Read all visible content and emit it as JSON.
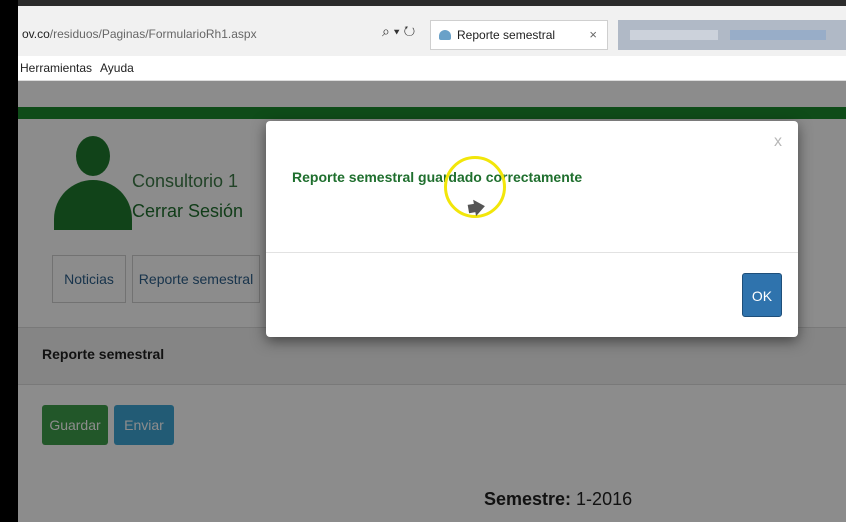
{
  "browser": {
    "url_prefix": "ov.co",
    "url_path": "/residuos/Paginas/FormularioRh1.aspx",
    "url_actions": "⌕ ▾ ↻",
    "tab_title": "Reporte semestral",
    "tab_close": "×"
  },
  "menubar": {
    "items": [
      "Herramientas",
      "Ayuda"
    ]
  },
  "page": {
    "user_label": "Consultorio 1",
    "logout_label": "Cerrar Sesión",
    "tabs": [
      "Noticias",
      "Reporte semestral"
    ],
    "panel_title": "Reporte semestral",
    "buttons": {
      "guardar": "Guardar",
      "enviar": "Enviar"
    },
    "semestre_label": "Semestre:",
    "semestre_value": " 1-2016"
  },
  "modal": {
    "close": "x",
    "message": "Reporte semestral guardado correctamente",
    "ok": "OK"
  },
  "colors": {
    "green": "#1c8a2e",
    "ok_button": "#2f73ad",
    "guardar_button": "#3f9e4b",
    "enviar_button": "#3ea6d6"
  },
  "icons": {
    "cursor": "mouse-pointer-icon",
    "avatar": "user-avatar-icon"
  }
}
